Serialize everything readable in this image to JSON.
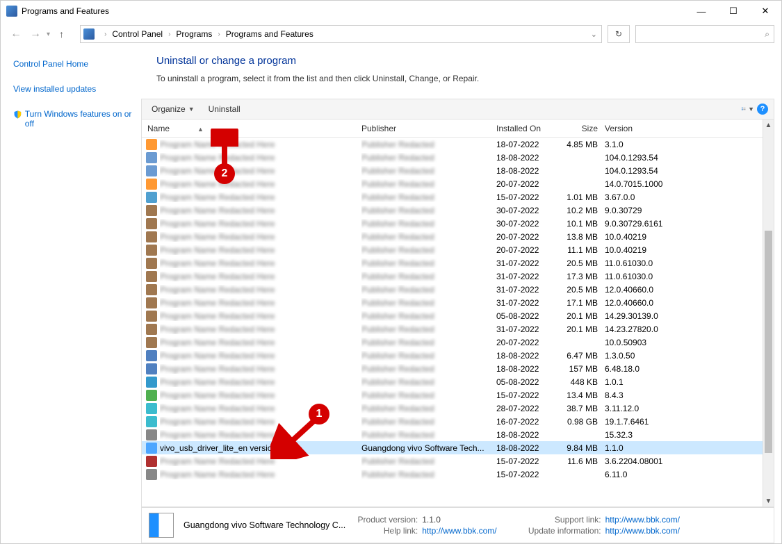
{
  "window": {
    "title": "Programs and Features"
  },
  "breadcrumb": {
    "p1": "Control Panel",
    "p2": "Programs",
    "p3": "Programs and Features"
  },
  "sidebar": {
    "home": "Control Panel Home",
    "updates": "View installed updates",
    "features": "Turn Windows features on or off"
  },
  "heading": "Uninstall or change a program",
  "subheading": "To uninstall a program, select it from the list and then click Uninstall, Change, or Repair.",
  "toolbar": {
    "organize": "Organize",
    "uninstall": "Uninstall"
  },
  "columns": {
    "name": "Name",
    "publisher": "Publisher",
    "installed": "Installed On",
    "size": "Size",
    "version": "Version"
  },
  "rows": [
    {
      "installed": "18-07-2022",
      "size": "4.85 MB",
      "version": "3.1.0"
    },
    {
      "installed": "18-08-2022",
      "size": "",
      "version": "104.0.1293.54"
    },
    {
      "installed": "18-08-2022",
      "size": "",
      "version": "104.0.1293.54"
    },
    {
      "installed": "20-07-2022",
      "size": "",
      "version": "14.0.7015.1000"
    },
    {
      "installed": "15-07-2022",
      "size": "1.01 MB",
      "version": "3.67.0.0"
    },
    {
      "installed": "30-07-2022",
      "size": "10.2 MB",
      "version": "9.0.30729"
    },
    {
      "installed": "30-07-2022",
      "size": "10.1 MB",
      "version": "9.0.30729.6161"
    },
    {
      "installed": "20-07-2022",
      "size": "13.8 MB",
      "version": "10.0.40219"
    },
    {
      "installed": "20-07-2022",
      "size": "11.1 MB",
      "version": "10.0.40219"
    },
    {
      "installed": "31-07-2022",
      "size": "20.5 MB",
      "version": "11.0.61030.0"
    },
    {
      "installed": "31-07-2022",
      "size": "17.3 MB",
      "version": "11.0.61030.0"
    },
    {
      "installed": "31-07-2022",
      "size": "20.5 MB",
      "version": "12.0.40660.0"
    },
    {
      "installed": "31-07-2022",
      "size": "17.1 MB",
      "version": "12.0.40660.0"
    },
    {
      "installed": "05-08-2022",
      "size": "20.1 MB",
      "version": "14.29.30139.0"
    },
    {
      "installed": "31-07-2022",
      "size": "20.1 MB",
      "version": "14.23.27820.0"
    },
    {
      "installed": "20-07-2022",
      "size": "",
      "version": "10.0.50903"
    },
    {
      "installed": "18-08-2022",
      "size": "6.47 MB",
      "version": "1.3.0.50"
    },
    {
      "installed": "18-08-2022",
      "size": "157 MB",
      "version": "6.48.18.0"
    },
    {
      "installed": "05-08-2022",
      "size": "448 KB",
      "version": "1.0.1"
    },
    {
      "installed": "15-07-2022",
      "size": "13.4 MB",
      "version": "8.4.3"
    },
    {
      "installed": "28-07-2022",
      "size": "38.7 MB",
      "version": "3.11.12.0"
    },
    {
      "installed": "16-07-2022",
      "size": "0.98 GB",
      "version": "19.1.7.6461"
    },
    {
      "installed": "18-08-2022",
      "size": "",
      "version": "15.32.3"
    },
    {
      "name": "vivo_usb_driver_lite_en version 1.1.0",
      "publisher": "Guangdong vivo Software Tech...",
      "installed": "18-08-2022",
      "size": "9.84 MB",
      "version": "1.1.0",
      "selected": true
    },
    {
      "installed": "15-07-2022",
      "size": "11.6 MB",
      "version": "3.6.2204.08001"
    },
    {
      "installed": "15-07-2022",
      "size": "",
      "version": "6.11.0"
    }
  ],
  "details": {
    "publisher": "Guangdong vivo Software Technology C...",
    "labels": {
      "productversion": "Product version:",
      "helplink": "Help link:",
      "supportlink": "Support link:",
      "updateinfo": "Update information:"
    },
    "productversion": "1.1.0",
    "helplink": "http://www.bbk.com/",
    "supportlink": "http://www.bbk.com/",
    "updateinfo": "http://www.bbk.com/"
  },
  "callouts": {
    "one": "1",
    "two": "2"
  }
}
